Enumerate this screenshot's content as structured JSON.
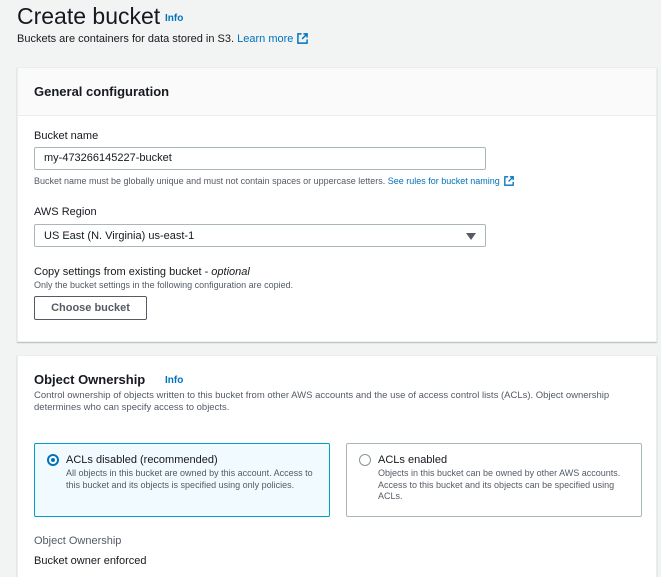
{
  "header": {
    "title": "Create bucket",
    "info": "Info",
    "description": "Buckets are containers for data stored in S3.",
    "learn_more": "Learn more"
  },
  "general": {
    "title": "General configuration",
    "bucket_name_label": "Bucket name",
    "bucket_name_value": "my-473266145227-bucket",
    "bucket_name_hint": "Bucket name must be globally unique and must not contain spaces or uppercase letters.",
    "rules_link": "See rules for bucket naming",
    "region_label": "AWS Region",
    "region_value": "US East (N. Virginia) us-east-1",
    "copy_label": "Copy settings from existing bucket - ",
    "copy_optional": "optional",
    "copy_hint": "Only the bucket settings in the following configuration are copied.",
    "choose_button": "Choose bucket"
  },
  "ownership": {
    "title": "Object Ownership",
    "info": "Info",
    "description": "Control ownership of objects written to this bucket from other AWS accounts and the use of access control lists (ACLs). Object ownership determines who can specify access to objects.",
    "options": [
      {
        "label": "ACLs disabled (recommended)",
        "description": "All objects in this bucket are owned by this account. Access to this bucket and its objects is specified using only policies.",
        "selected": true
      },
      {
        "label": "ACLs enabled",
        "description": "Objects in this bucket can be owned by other AWS accounts. Access to this bucket and its objects can be specified using ACLs.",
        "selected": false
      }
    ],
    "field_label": "Object Ownership",
    "field_value": "Bucket owner enforced"
  },
  "colors": {
    "link": "#0073bb",
    "selected_border": "#00a1c9",
    "selected_bg": "#f1faff"
  },
  "icons": [
    "external-link-icon",
    "caret-down-icon",
    "radio-checked-icon",
    "radio-unchecked-icon"
  ]
}
